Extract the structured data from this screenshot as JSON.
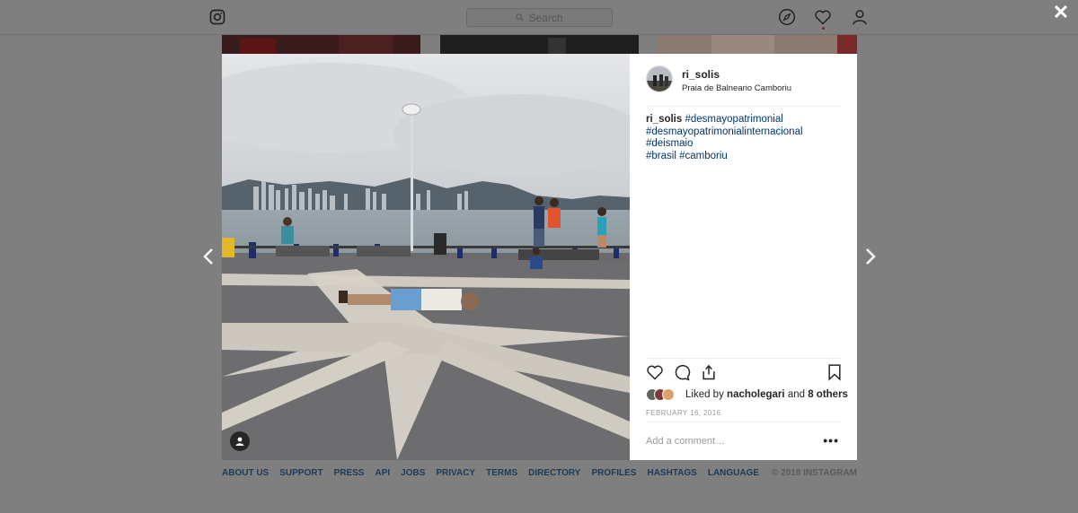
{
  "nav": {
    "search_placeholder": "Search"
  },
  "close_glyph": "✕",
  "post": {
    "username": "ri_solis",
    "location": "Praia de Balneario Camboriu",
    "caption_user": "ri_solis",
    "hashtags": [
      "#desmayopatrimonial",
      "#desmayopatrimonialinternacional",
      "#deismaio",
      "#brasil",
      "#camboriu"
    ],
    "liked_by_prefix": "Liked by",
    "liked_by_user": "nacholegari",
    "liked_by_and": "and",
    "liked_by_others": "8 others",
    "date": "FEBRUARY 16, 2016",
    "comment_placeholder": "Add a comment…",
    "more_glyph": "•••"
  },
  "footer": {
    "links": [
      "ABOUT US",
      "SUPPORT",
      "PRESS",
      "API",
      "JOBS",
      "PRIVACY",
      "TERMS",
      "DIRECTORY",
      "PROFILES",
      "HASHTAGS",
      "LANGUAGE"
    ],
    "copyright": "© 2018 INSTAGRAM"
  },
  "colors": {
    "overlay": "#7f7f7f",
    "hashtag": "#003569",
    "footer_link": "#1f3a57"
  },
  "icons": [
    "instagram-logo-icon",
    "search-icon",
    "compass-icon",
    "heart-icon",
    "user-icon",
    "close-icon",
    "chevron-left-icon",
    "chevron-right-icon",
    "comment-icon",
    "share-icon",
    "bookmark-icon",
    "user-tag-icon"
  ]
}
